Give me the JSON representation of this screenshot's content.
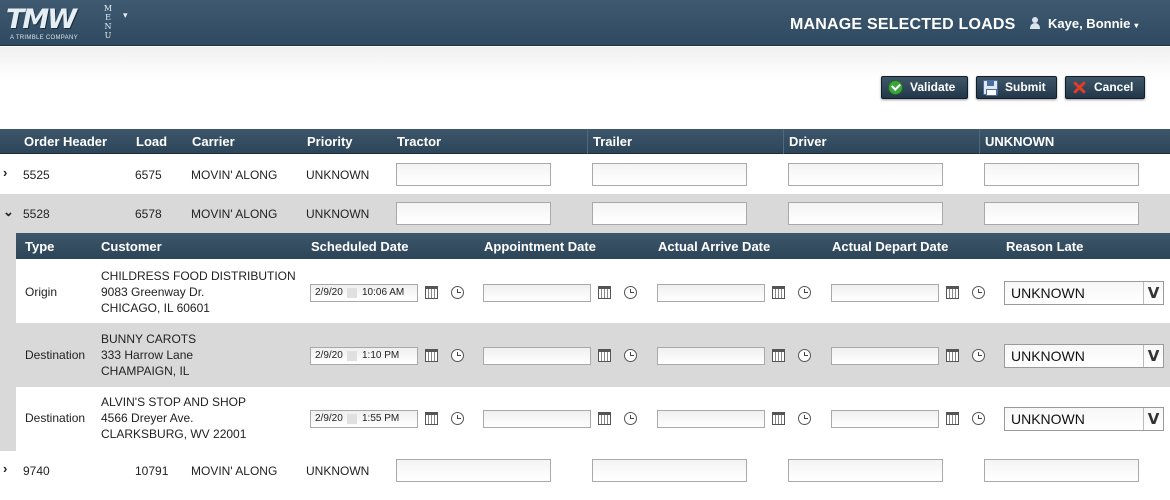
{
  "header": {
    "logo_text": "TMW",
    "logo_subtitle": "A TRIMBLE COMPANY",
    "menu_label": "MENU",
    "menu_caret": "▾",
    "page_title": "MANAGE SELECTED LOADS",
    "user_name": "Kaye, Bonnie",
    "user_caret": "▾"
  },
  "toolbar": {
    "validate_label": "Validate",
    "submit_label": "Submit",
    "cancel_label": "Cancel"
  },
  "loads_table": {
    "columns": [
      "Order Header",
      "Load",
      "Carrier",
      "Priority",
      "Tractor",
      "Trailer",
      "Driver",
      "UNKNOWN"
    ],
    "rows": [
      {
        "order_header": "5525",
        "load": "6575",
        "carrier": "MOVIN' ALONG",
        "priority": "UNKNOWN",
        "expander": "›",
        "tractor": "",
        "trailer": "",
        "driver": "",
        "unknown": ""
      },
      {
        "order_header": "5528",
        "load": "6578",
        "carrier": "MOVIN' ALONG",
        "priority": "UNKNOWN",
        "expander": "⌄",
        "tractor": "",
        "trailer": "",
        "driver": "",
        "unknown": ""
      },
      {
        "order_header": "9740",
        "load": "10791",
        "carrier": "MOVIN' ALONG",
        "priority": "UNKNOWN",
        "expander": "›",
        "tractor": "",
        "trailer": "",
        "driver": "",
        "unknown": ""
      }
    ]
  },
  "stops_table": {
    "columns": [
      "Type",
      "Customer",
      "Scheduled Date",
      "Appointment Date",
      "Actual Arrive Date",
      "Actual Depart Date",
      "Reason Late"
    ],
    "rows": [
      {
        "type": "Origin",
        "customer_lines": [
          "CHILDRESS FOOD DISTRIBUTION",
          "9083 Greenway Dr.",
          "CHICAGO, IL 60601"
        ],
        "scheduled_date": "2/9/20",
        "scheduled_time": "10:06 AM",
        "reason_late": "UNKNOWN"
      },
      {
        "type": "Destination",
        "customer_lines": [
          "BUNNY CAROTS",
          "333 Harrow Lane",
          "CHAMPAIGN, IL"
        ],
        "scheduled_date": "2/9/20",
        "scheduled_time": "1:10 PM",
        "reason_late": "UNKNOWN"
      },
      {
        "type": "Destination",
        "customer_lines": [
          "ALVIN'S STOP AND SHOP",
          "4566 Dreyer Ave.",
          "CLARKSBURG, WV 22001"
        ],
        "scheduled_date": "2/9/20",
        "scheduled_time": "1:55 PM",
        "reason_late": "UNKNOWN"
      }
    ],
    "select_arrow": "V"
  },
  "colors": {
    "header_bg": "#2f4a60",
    "alt_row_bg": "#d9d9d9",
    "validate_icon": "#3ea33e",
    "cancel_icon": "#e23b2a"
  },
  "icons": [
    "check-icon",
    "save-disk-icon",
    "cancel-x-icon",
    "user-icon",
    "calendar-icon",
    "clock-icon",
    "chevron-right-icon",
    "chevron-down-icon"
  ]
}
